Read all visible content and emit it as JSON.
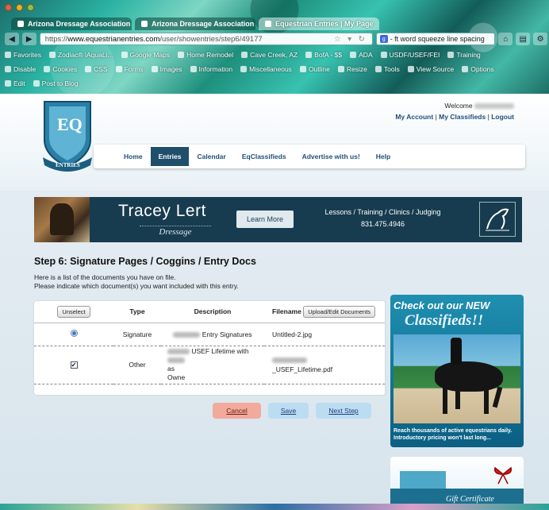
{
  "browser": {
    "tabs": [
      {
        "label": "Arizona Dressage Association"
      },
      {
        "label": "Arizona Dressage Association -"
      },
      {
        "label": "Equestrian Entries | My Page"
      }
    ],
    "url_prefix": "https://",
    "url_host": "www.equestrianentries.com",
    "url_path": "/user/showentries/step6/49177",
    "search_value": "- ft word squeeze line spacing",
    "bookmarks": [
      "Favorites",
      "Zodiac® iAquaLi...",
      "Google Maps",
      "Home Remodel",
      "Cave Creek, AZ",
      "BofA - $$",
      "ADA",
      "USDF/USEF/FEI",
      "Training"
    ],
    "toolbar2": [
      "Disable",
      "Cookies",
      "CSS",
      "Forms",
      "Images",
      "Information",
      "Miscellaneous",
      "Outline",
      "Resize",
      "Tools",
      "View Source",
      "Options"
    ],
    "toolbar3": [
      "Edit",
      "Post to Blog"
    ]
  },
  "header": {
    "logo_letters": "EQ",
    "logo_ribbon": "ENTRIES",
    "welcome_label": "Welcome",
    "my_account": "My Account",
    "my_classifieds": "My Classifieds",
    "logout": "Logout",
    "sep": "|"
  },
  "nav": {
    "items": [
      {
        "label": "Home",
        "active": false
      },
      {
        "label": "Entries",
        "active": true
      },
      {
        "label": "Calendar",
        "active": false
      },
      {
        "label": "EqClassifieds",
        "active": false
      },
      {
        "label": "Advertise with us!",
        "active": false
      },
      {
        "label": "Help",
        "active": false
      }
    ]
  },
  "banner": {
    "name": "Tracey Lert",
    "subtitle": "Dressage",
    "learn_more": "Learn More",
    "services": "Lessons / Training / Clinics / Judging",
    "phone": "831.475.4946"
  },
  "main": {
    "heading": "Step 6: Signature Pages / Coggins / Entry Docs",
    "intro_line1": "Here is a list of the documents you have on file.",
    "intro_line2": "Please indicate which document(s) you want included with this entry.",
    "table": {
      "unselect_label": "Unselect",
      "headers": [
        "Type",
        "Description",
        "Filename"
      ],
      "upload_label": "Upload/Edit Documents",
      "rows": [
        {
          "type": "Signature",
          "description": "Entry Signatures",
          "filename": "Untitled-2.jpg",
          "control": "radio"
        },
        {
          "type": "Other",
          "description_a": "USEF Lifetime with",
          "description_b": "as",
          "description_c": "Owne",
          "filename": "_USEF_Lifetime.pdf",
          "control": "checkbox"
        }
      ]
    },
    "buttons": {
      "cancel": "Cancel",
      "save": "Save",
      "next": "Next Step"
    }
  },
  "ads": {
    "classifieds_line1": "Check out our NEW",
    "classifieds_line2": "Classifieds!!",
    "classifieds_footer1": "Reach thousands of active equestrians daily.",
    "classifieds_footer2": "Introductory pricing won't last long...",
    "gift": "Gift Certificate"
  },
  "colors": {
    "nav_active": "#1f4f6b",
    "link": "#1d4f7a",
    "cancel": "#f1aa9c",
    "save": "#bcdcf2"
  }
}
